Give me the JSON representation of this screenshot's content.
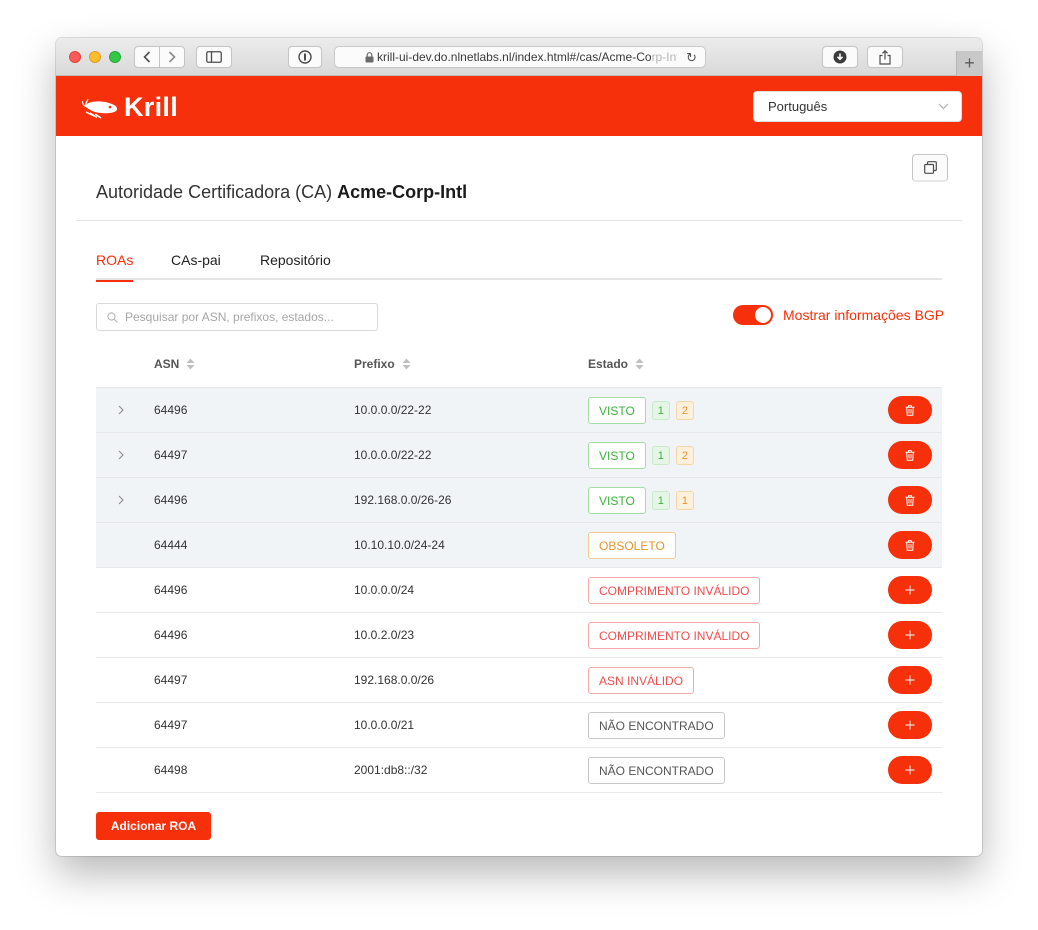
{
  "browser": {
    "url": "krill-ui-dev.do.nlnetlabs.nl/index.html#/cas/Acme-Co",
    "url_fade": "rp-Intl"
  },
  "header": {
    "logo_text": "Krill",
    "language": "Português",
    "brand_color": "#f6300a"
  },
  "page": {
    "title_prefix": "Autoridade Certificadora (CA)",
    "ca_name": "Acme-Corp-Intl"
  },
  "tabs": [
    {
      "label": "ROAs",
      "active": true
    },
    {
      "label": "CAs-pai",
      "active": false
    },
    {
      "label": "Repositório",
      "active": false
    }
  ],
  "search": {
    "placeholder": "Pesquisar por ASN, prefixos, estados...",
    "value": ""
  },
  "bgp_toggle": {
    "label": "Mostrar informações BGP",
    "on": true
  },
  "table": {
    "headers": {
      "asn": "ASN",
      "prefix": "Prefixo",
      "state": "Estado"
    },
    "rows": [
      {
        "asn": "64496",
        "prefix": "10.0.0.0/22-22",
        "state": "VISTO",
        "counts": [
          "1",
          "2"
        ],
        "expandable": true,
        "action": "delete"
      },
      {
        "asn": "64497",
        "prefix": "10.0.0.0/22-22",
        "state": "VISTO",
        "counts": [
          "1",
          "2"
        ],
        "expandable": true,
        "action": "delete"
      },
      {
        "asn": "64496",
        "prefix": "192.168.0.0/26-26",
        "state": "VISTO",
        "counts": [
          "1",
          "1"
        ],
        "expandable": true,
        "action": "delete"
      },
      {
        "asn": "64444",
        "prefix": "10.10.10.0/24-24",
        "state": "OBSOLETO",
        "counts": [],
        "expandable": false,
        "action": "delete"
      },
      {
        "asn": "64496",
        "prefix": "10.0.0.0/24",
        "state": "COMPRIMENTO INVÁLIDO",
        "counts": [],
        "expandable": false,
        "action": "add"
      },
      {
        "asn": "64496",
        "prefix": "10.0.2.0/23",
        "state": "COMPRIMENTO INVÁLIDO",
        "counts": [],
        "expandable": false,
        "action": "add"
      },
      {
        "asn": "64497",
        "prefix": "192.168.0.0/26",
        "state": "ASN INVÁLIDO",
        "counts": [],
        "expandable": false,
        "action": "add"
      },
      {
        "asn": "64497",
        "prefix": "10.0.0.0/21",
        "state": "NÃO ENCONTRADO",
        "counts": [],
        "expandable": false,
        "action": "add"
      },
      {
        "asn": "64498",
        "prefix": "2001:db8::/32",
        "state": "NÃO ENCONTRADO",
        "counts": [],
        "expandable": false,
        "action": "add"
      }
    ]
  },
  "add_button": {
    "label": "Adicionar ROA"
  },
  "icons": {
    "expander": "chevron-right-icon",
    "sort": "sort-icon",
    "delete": "trash-icon",
    "add": "plus-icon"
  }
}
